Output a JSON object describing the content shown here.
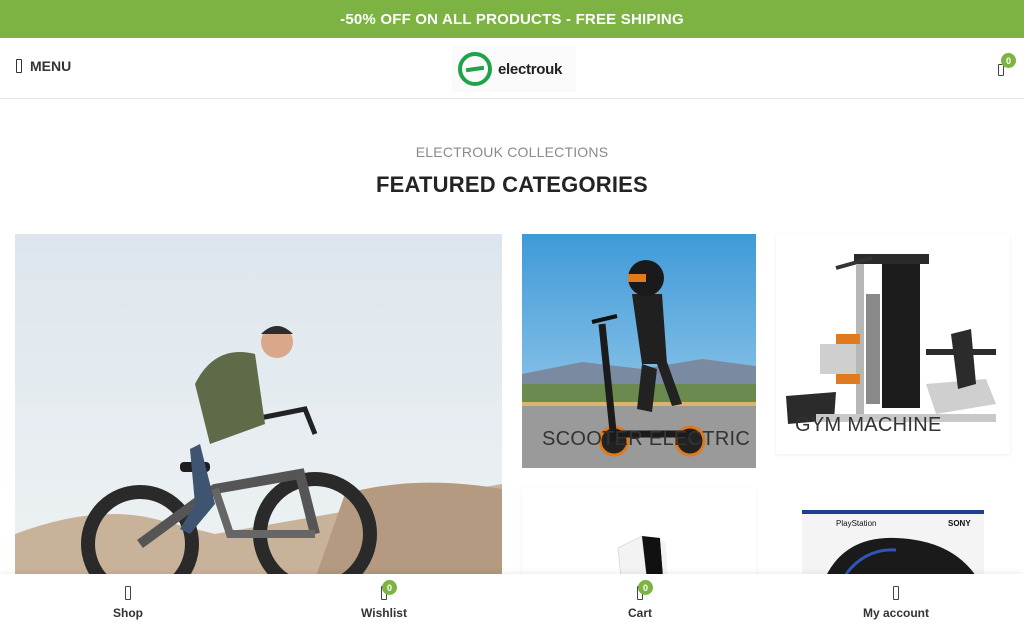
{
  "promo": {
    "text": "-50% OFF ON ALL PRODUCTS - FREE SHIPING"
  },
  "header": {
    "menu_label": "MENU",
    "logo_text": "electrouk",
    "cart_count": "0"
  },
  "section": {
    "eyebrow": "ELECTROUK COLLECTIONS",
    "title": "FEATURED CATEGORIES"
  },
  "categories": [
    {
      "label": "",
      "image": "person-on-electric-bike"
    },
    {
      "label": "SCOOTER ELECTRIC",
      "image": "rider-on-electric-scooter"
    },
    {
      "label": "GYM MACHINE",
      "image": "gym-machine"
    },
    {
      "label": "",
      "image": "game-console"
    },
    {
      "label": "",
      "image": "playstation-controller-box"
    }
  ],
  "bottom_nav": [
    {
      "label": "Shop",
      "icon": "shop-icon"
    },
    {
      "label": "Wishlist",
      "icon": "heart-icon",
      "count": "0"
    },
    {
      "label": "Cart",
      "icon": "cart-icon",
      "count": "0"
    },
    {
      "label": "My account",
      "icon": "user-icon"
    }
  ],
  "colors": {
    "accent": "#7cb342",
    "logo_green": "#1fa34a",
    "text": "#242424",
    "muted": "#8a8a8a"
  }
}
